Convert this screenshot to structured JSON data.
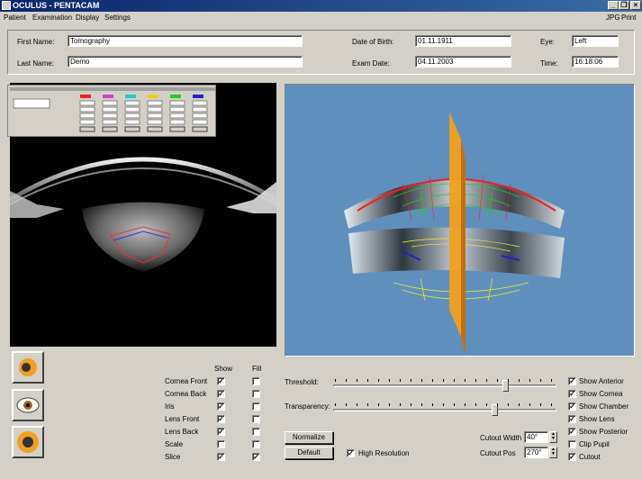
{
  "window": {
    "title": "OCULUS - PENTACAM",
    "minimize_glyph": "_",
    "restore_glyph": "❐",
    "close_glyph": "×"
  },
  "menu": {
    "items": [
      "Patient",
      "Examination",
      "Display",
      "Settings"
    ],
    "right_items": [
      "JPG",
      "Print"
    ]
  },
  "patient": {
    "first_name_label": "First Name:",
    "first_name": "Tomography",
    "last_name_label": "Last Name:",
    "last_name": "Demo",
    "dob_label": "Date of Birth:",
    "dob": "01.11.1911",
    "exam_date_label": "Exam Date:",
    "exam_date": "04.11.2003",
    "eye_label": "Eye:",
    "eye": "Left",
    "time_label": "Time:",
    "time": "16:18:06"
  },
  "display_table": {
    "show_header": "Show",
    "fill_header": "Fill",
    "rows": [
      {
        "label": "Cornea Front",
        "show": true,
        "fill": false
      },
      {
        "label": "Cornea Back",
        "show": true,
        "fill": false
      },
      {
        "label": "Iris",
        "show": true,
        "fill": false
      },
      {
        "label": "Lens Front",
        "show": true,
        "fill": false
      },
      {
        "label": "Lens Back",
        "show": true,
        "fill": false
      },
      {
        "label": "Scale",
        "show": false,
        "fill": false
      },
      {
        "label": "Slice",
        "show": true,
        "fill": true
      }
    ]
  },
  "controls": {
    "threshold_label": "Threshold:",
    "threshold_level": 0.77,
    "transparency_label": "Transparency:",
    "transparency_level": 0.72,
    "normalize_label": "Normalize",
    "default_label": "Default",
    "high_resolution_label": "High Resolution",
    "high_resolution": true,
    "cutout_width_label": "Cutout Width",
    "cutout_width": "40°",
    "cutout_pos_label": "Cutout Pos",
    "cutout_pos": "270°",
    "checked_glyph": "✓"
  },
  "options": [
    {
      "label": "Show Anterior",
      "checked": true
    },
    {
      "label": "Show Cornea",
      "checked": true
    },
    {
      "label": "Show Chamber",
      "checked": true
    },
    {
      "label": "Show Lens",
      "checked": true
    },
    {
      "label": "Show Posterior",
      "checked": true
    },
    {
      "label": "Clip Pupil",
      "checked": false
    },
    {
      "label": "Cutout",
      "checked": true
    }
  ],
  "colors": {
    "titlebar": "#0a246a",
    "background_3d": "#5f8fbd",
    "slice_plane": "#f0a020"
  }
}
